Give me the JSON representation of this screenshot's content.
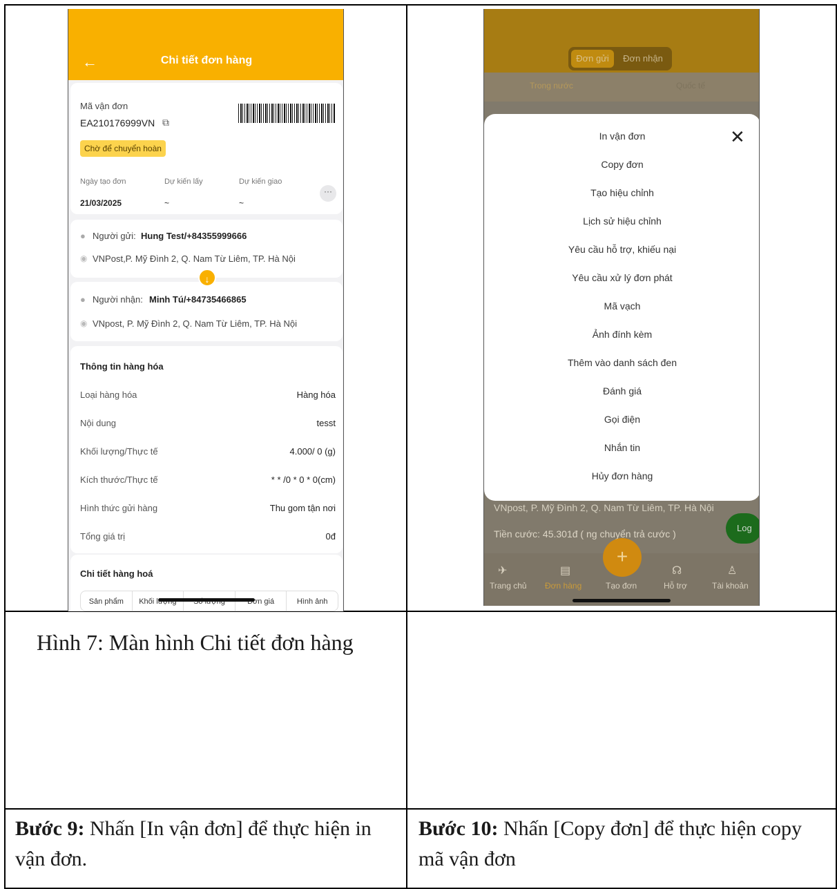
{
  "phone1": {
    "title": "Chi tiết đơn hàng",
    "back_icon": "←",
    "order": {
      "code_label": "Mã vận đơn",
      "code": "EA210176999VN",
      "copy_icon": "⧉",
      "status": "Chờ để chuyển hoàn",
      "created_label": "Ngày tạo đơn",
      "created_value": "21/03/2025",
      "pickup_label": "Dự kiến lấy",
      "pickup_value": "~",
      "delivery_label": "Dự kiến giao",
      "delivery_value": "~",
      "more_icon": "···"
    },
    "sender": {
      "label": "Người gửi:",
      "value": "Hung Test/+84355999666",
      "address": "VNPost,P. Mỹ Đình 2, Q. Nam Từ Liêm, TP. Hà Nội"
    },
    "receiver": {
      "label": "Người nhận:",
      "value": "Minh Tú/+84735466865",
      "address": "VNpost, P. Mỹ Đình 2, Q. Nam Từ Liêm, TP. Hà Nội"
    },
    "swap_icon": "↓",
    "goods": {
      "title": "Thông tin hàng hóa",
      "rows": [
        {
          "label": "Loại hàng hóa",
          "value": "Hàng hóa"
        },
        {
          "label": "Nội dung",
          "value": "tesst"
        },
        {
          "label": "Khối lượng/Thực tế",
          "value": "4.000/ 0 (g)"
        },
        {
          "label": "Kích thước/Thực tế",
          "value": "* * /0 * 0 * 0(cm)"
        },
        {
          "label": "Hình thức gửi hàng",
          "value": "Thu gom tận nơi"
        },
        {
          "label": "Tổng giá trị",
          "value": "0đ"
        }
      ]
    },
    "detail": {
      "title": "Chi tiết hàng hoá",
      "columns": [
        "Sản phẩm",
        "Khối lượng",
        "Số lượng",
        "Đơn giá",
        "Hình ảnh"
      ]
    }
  },
  "phone2": {
    "segment": {
      "active": "Đơn gửi",
      "inactive": "Đơn nhận"
    },
    "tabs": {
      "left": "Trong nước",
      "right": "Quốc tế"
    },
    "close_icon": "✕",
    "menu": [
      "In vận đơn",
      "Copy đơn",
      "Tạo hiệu chỉnh",
      "Lịch sử hiệu chỉnh",
      "Yêu cầu hỗ trợ, khiếu nại",
      "Yêu cầu xử lý đơn phát",
      "Mã vạch",
      "Ảnh đính kèm",
      "Thêm vào danh sách đen",
      "Đánh giá",
      "Gọi điện",
      "Nhắn tin",
      "Hủy đơn hàng"
    ],
    "address": "VNpost, P. Mỹ Đình 2, Q. Nam Từ Liêm, TP. Hà Nội",
    "fee": "Tiền cước: 45.301đ ( ng  chuyển trả cước )",
    "log_label": "Log",
    "fab_icon": "+",
    "tabbar": [
      {
        "label": "Trang chủ",
        "icon": "✈"
      },
      {
        "label": "Đơn hàng",
        "icon": "▤"
      },
      {
        "label": "Tạo đơn",
        "icon": ""
      },
      {
        "label": "Hỗ trợ",
        "icon": "☊"
      },
      {
        "label": "Tài khoản",
        "icon": "♙"
      }
    ]
  },
  "caption": "Hình 7: Màn hình Chi tiết đơn hàng",
  "step9": {
    "bold": "Bước 9:",
    "text": " Nhấn [In vận đơn] để thực hiện in vận đơn."
  },
  "step10": {
    "bold": "Bước 10:",
    "text": " Nhấn [Copy đơn] để thực hiện copy mã vận đơn"
  }
}
